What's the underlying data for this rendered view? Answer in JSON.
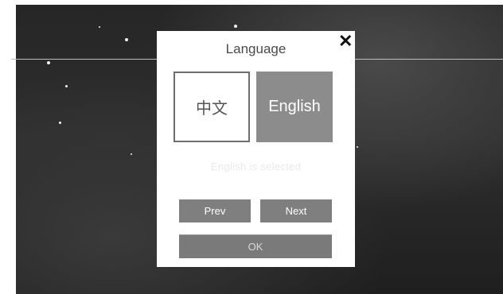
{
  "dialog": {
    "title": "Language",
    "close_glyph": "✕",
    "options": [
      {
        "label": "中文",
        "selected": false
      },
      {
        "label": "English",
        "selected": true
      }
    ],
    "status_text": "English is selected",
    "prev_label": "Prev",
    "next_label": "Next",
    "ok_label": "OK"
  },
  "colors": {
    "backdrop": "#262626",
    "selected_option": "#8c8c8c",
    "button": "#7f7f7f"
  }
}
